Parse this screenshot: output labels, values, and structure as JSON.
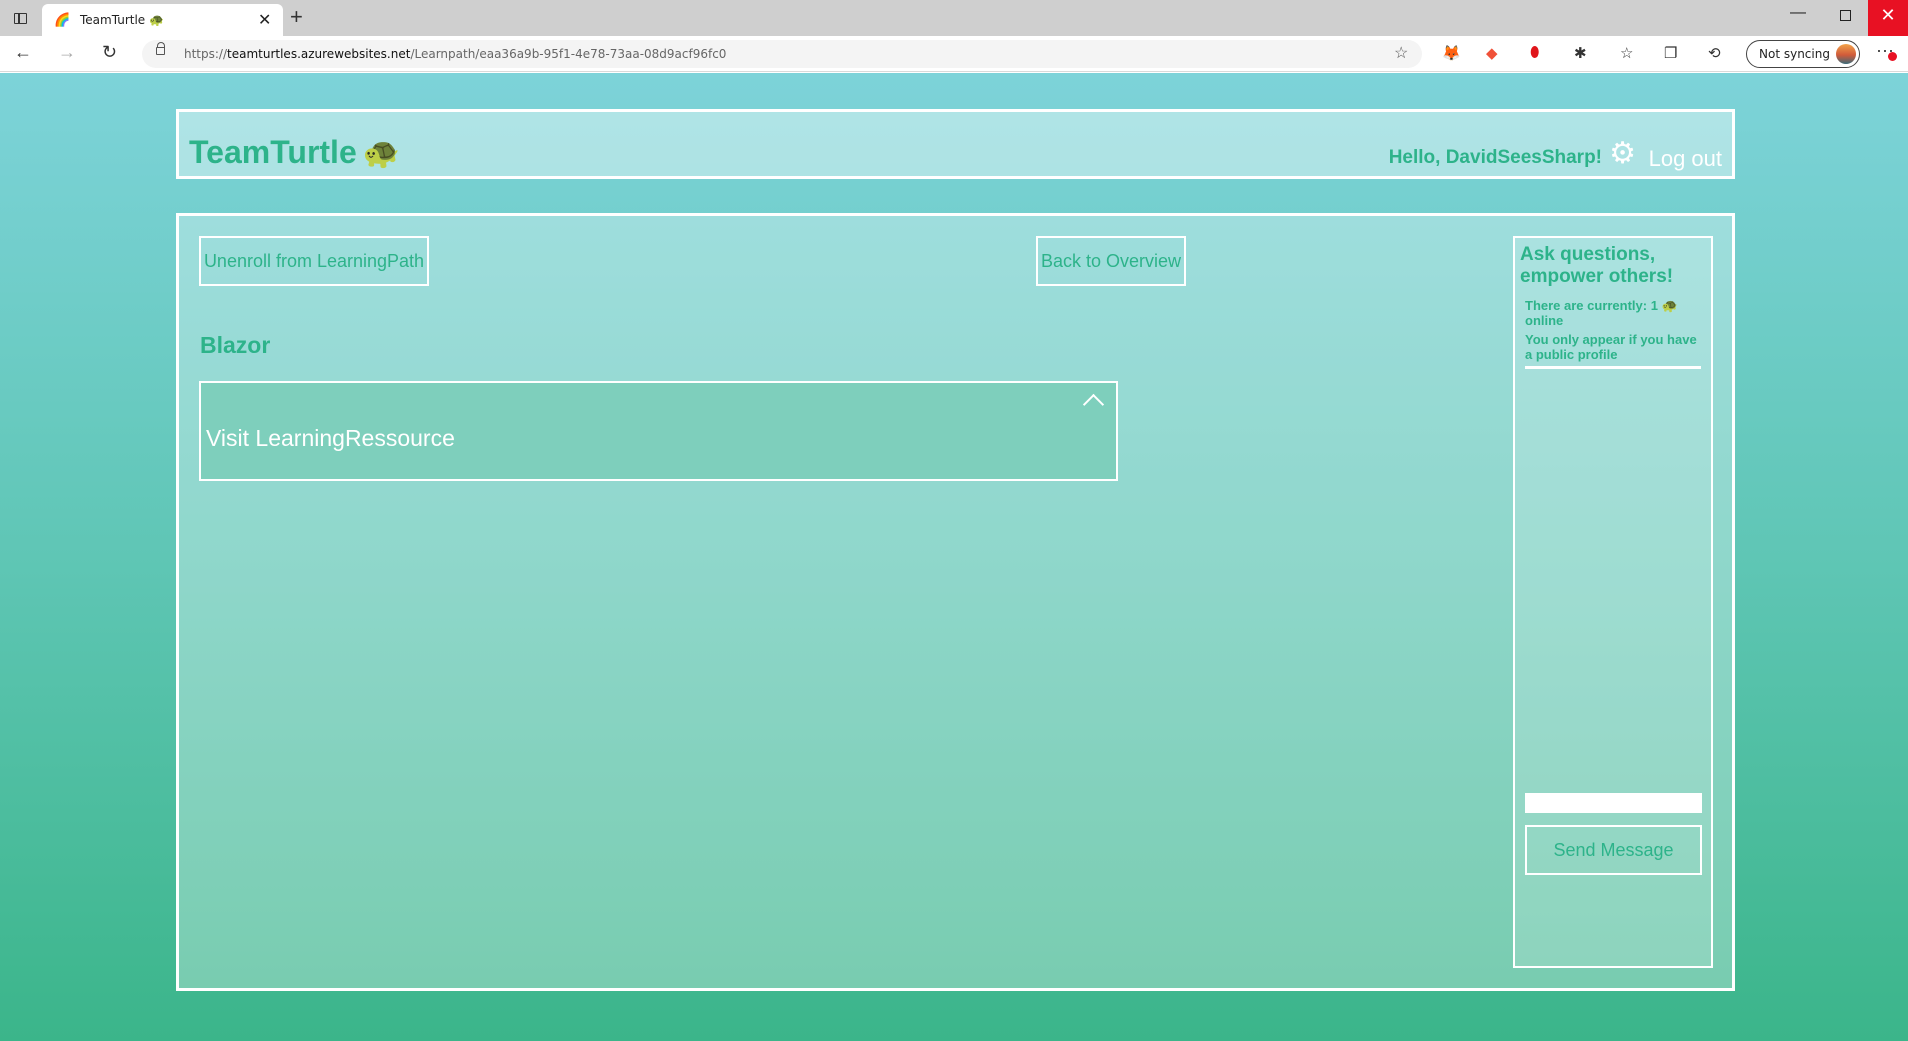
{
  "browser": {
    "tab_title": "TeamTurtle 🐢",
    "tab_favicon": "🌈",
    "url_domain": "teamturtles.azurewebsites.net",
    "url_prefix": "https://",
    "url_path": "/Learnpath/eaa36a9b-95f1-4e78-73aa-08d9acf96fc0",
    "sync_label": "Not syncing"
  },
  "header": {
    "brand": "TeamTurtle",
    "brand_emoji": "🐢",
    "greeting": "Hello, DavidSeesSharp!",
    "logout_label": "Log out"
  },
  "main": {
    "unenroll_label": "Unenroll from LearningPath",
    "back_label": "Back to Overview",
    "learning_path_title": "Blazor",
    "resource_link_label": "Visit LearningRessource"
  },
  "chat": {
    "title": "Ask questions, empower others!",
    "online_text": "There are currently: 1 🐢 online",
    "note": "You only appear if you have a public profile",
    "input_value": "",
    "send_label": "Send Message"
  },
  "colors": {
    "accent": "#2db38a",
    "gradient_top": "#7dd3d9",
    "gradient_bottom": "#3bb58a"
  }
}
